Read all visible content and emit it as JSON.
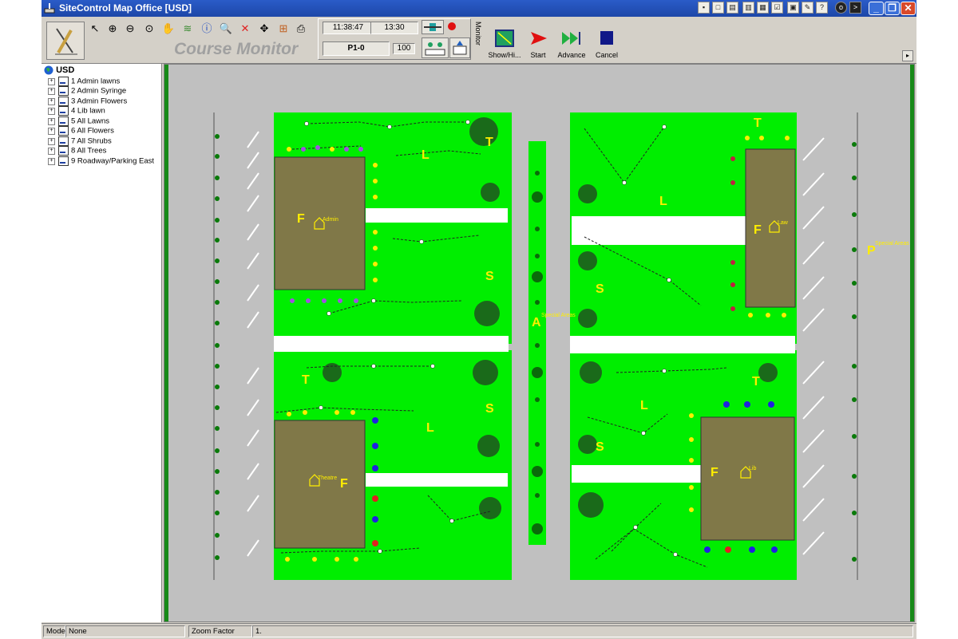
{
  "app": {
    "title": "SiteControl Map Office [USD]"
  },
  "toolbar": {
    "course_monitor_label": "Course Monitor",
    "clock_time": "11:38:47",
    "schedule_time": "13:30",
    "program_label": "P1-0",
    "percent_value": "100",
    "monitor_label": "Monitor",
    "actions": [
      {
        "label": "Show/Hi..."
      },
      {
        "label": "Start"
      },
      {
        "label": "Advance"
      },
      {
        "label": "Cancel"
      }
    ]
  },
  "tree": {
    "root_label": "USD",
    "items": [
      {
        "label": "1 Admin lawns"
      },
      {
        "label": "2 Admin Syringe"
      },
      {
        "label": "3 Admin Flowers"
      },
      {
        "label": "4 Lib lawn"
      },
      {
        "label": "5 All Lawns"
      },
      {
        "label": "6 All Flowers"
      },
      {
        "label": "7 All Shrubs"
      },
      {
        "label": "8 All Trees"
      },
      {
        "label": "9 Roadway/Parking East"
      }
    ]
  },
  "map": {
    "buildings": [
      {
        "label": "Admin",
        "letter": "F"
      },
      {
        "label": "Law",
        "letter": "F"
      },
      {
        "label": "Theatre",
        "letter": "F"
      },
      {
        "label": "Lib",
        "letter": "F"
      }
    ],
    "area_labels": [
      {
        "text": "Special Areas",
        "letter": "A"
      },
      {
        "text": "Special Areas",
        "letter": "P"
      }
    ],
    "zone_letters": [
      "T",
      "L",
      "S",
      "T",
      "L",
      "S",
      "T",
      "L",
      "S",
      "T",
      "L",
      "S"
    ]
  },
  "status": {
    "mode_label": "Mode",
    "mode_value": "None",
    "zoom_label": "Zoom Factor",
    "zoom_value": "1."
  },
  "colors": {
    "grass": "#00ee00",
    "building": "#807848",
    "sprinkler_label": "#ffff00",
    "titlebar": "#1d47a8"
  }
}
